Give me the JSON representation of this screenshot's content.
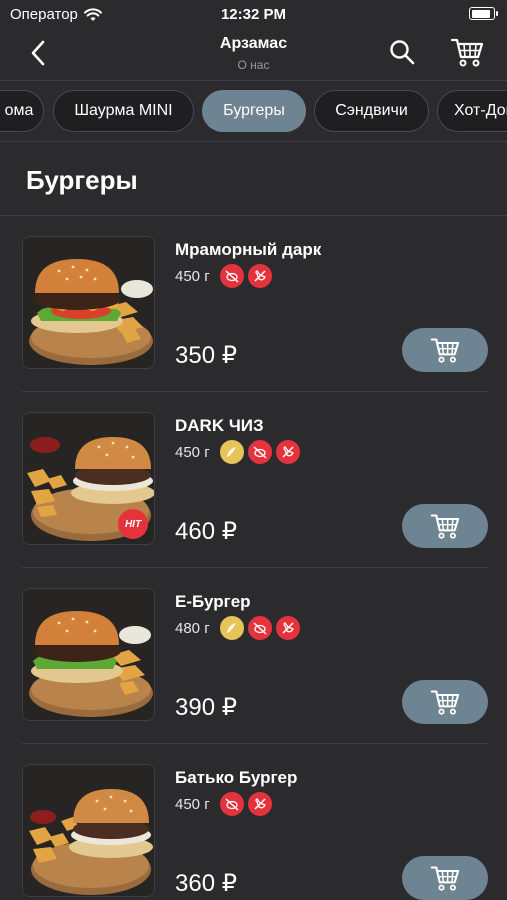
{
  "status": {
    "carrier": "Оператор",
    "time": "12:32 PM"
  },
  "header": {
    "title": "Арзамас",
    "subtitle": "О нас"
  },
  "categories": [
    {
      "label": "ома",
      "active": false
    },
    {
      "label": "Шаурма MINI",
      "active": false
    },
    {
      "label": "Бургеры",
      "active": true
    },
    {
      "label": "Сэндвичи",
      "active": false
    },
    {
      "label": "Хот-Доги",
      "active": false
    }
  ],
  "section": {
    "title": "Бургеры"
  },
  "products": [
    {
      "name": "Мраморный дарк",
      "weight": "450 г",
      "price": "350 ₽",
      "badges": [
        "no-pork",
        "no-chicken"
      ],
      "hit": false
    },
    {
      "name": "DARK ЧИЗ",
      "weight": "450 г",
      "price": "460 ₽",
      "badges": [
        "spicy-mild",
        "no-pork",
        "no-chicken"
      ],
      "hit": true,
      "hit_label": "HIT"
    },
    {
      "name": "Е-Бургер",
      "weight": "480 г",
      "price": "390 ₽",
      "badges": [
        "spicy-mild",
        "no-pork",
        "no-chicken"
      ],
      "hit": false
    },
    {
      "name": "Батько Бургер",
      "weight": "450 г",
      "price": "360 ₽",
      "badges": [
        "no-pork",
        "no-chicken"
      ],
      "hit": false
    }
  ],
  "colors": {
    "background": "#2b2b2e",
    "accent": "#6e8493",
    "badge_red": "#e5333d",
    "badge_gold": "#e8c35a"
  }
}
